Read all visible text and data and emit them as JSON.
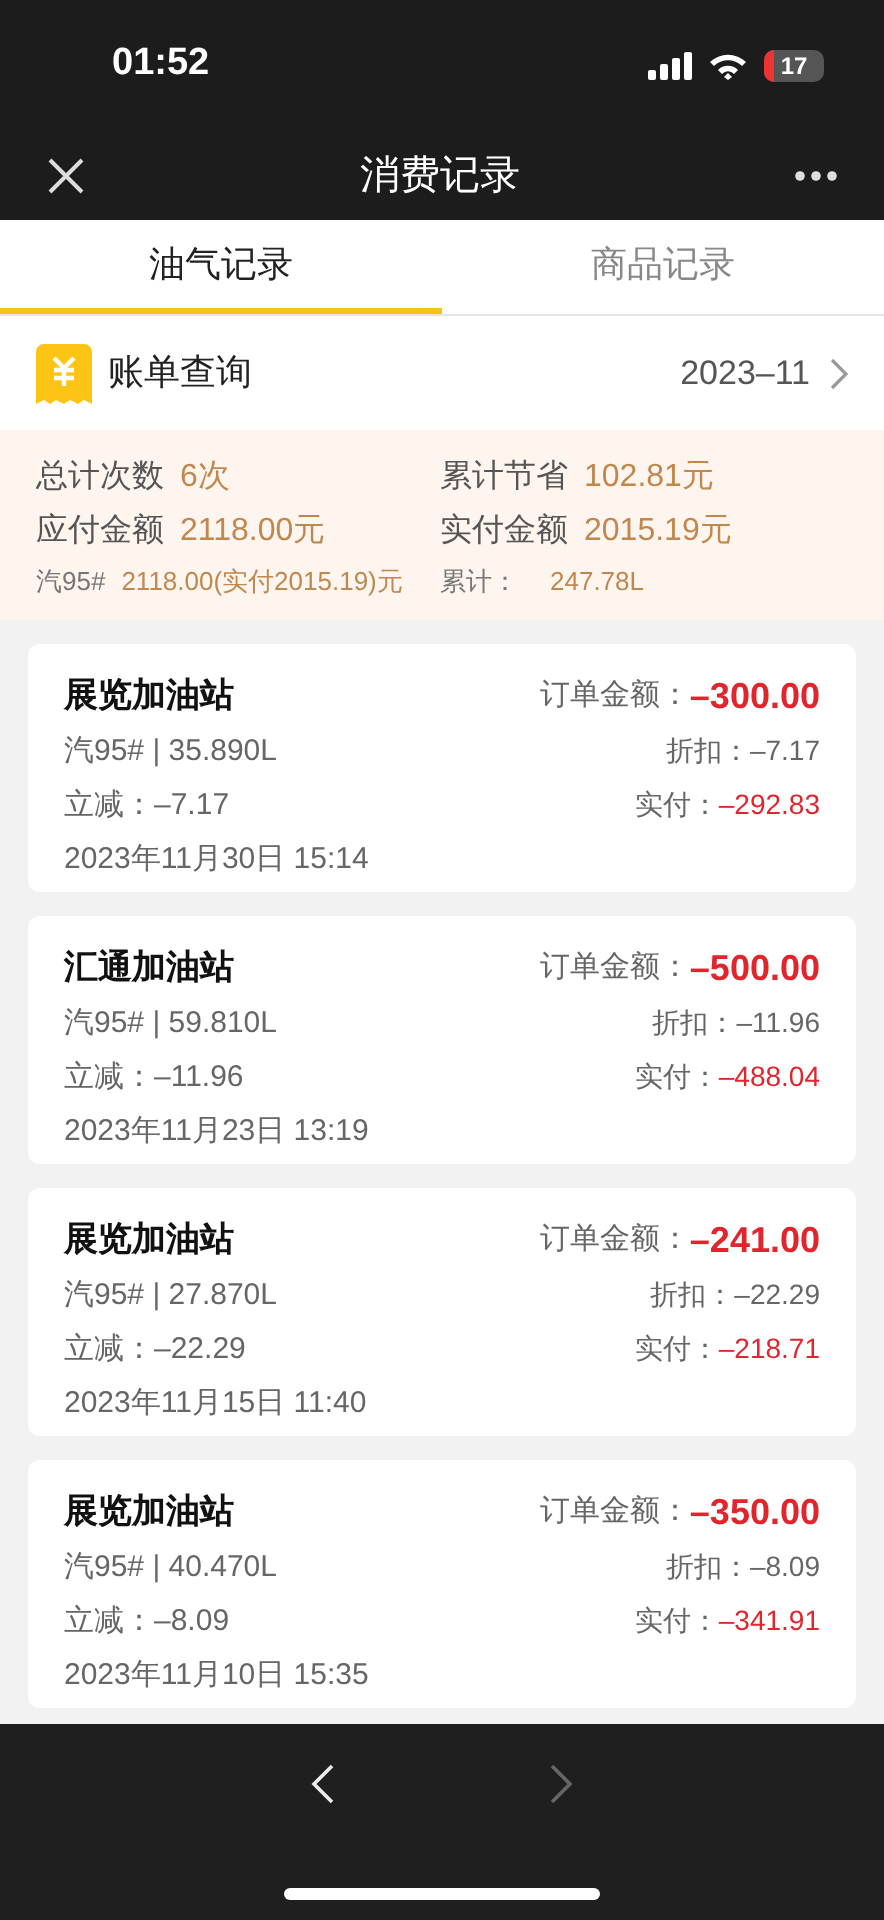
{
  "status_bar": {
    "time": "01:52",
    "battery": "17"
  },
  "nav": {
    "title": "消费记录"
  },
  "tabs": [
    {
      "label": "油气记录",
      "selected": true
    },
    {
      "label": "商品记录",
      "selected": false
    }
  ],
  "bill": {
    "label": "账单查询",
    "month": "2023–11"
  },
  "summary": {
    "rows": [
      {
        "label": "总计次数",
        "value": "6次",
        "label_2": "累计节省",
        "value_2": "102.81元"
      },
      {
        "label": "应付金额",
        "value": "2118.00元",
        "label_2": "实付金额",
        "value_2": "2015.19元"
      }
    ],
    "fuel": {
      "label": "汽95#",
      "value": "2118.00(实付2015.19)元",
      "label_2": "累计：",
      "value_2": "247.78L"
    }
  },
  "records": [
    {
      "station": "展览加油站",
      "fuel": "汽95# | 35.890L",
      "reduction": "立减：–7.17",
      "date": "2023年11月30日 15:14",
      "order_label": "订单金额：",
      "order": "–300.00",
      "discount": "折扣：–7.17",
      "paid_label": "实付：",
      "paid": "–292.83"
    },
    {
      "station": "汇通加油站",
      "fuel": "汽95# | 59.810L",
      "reduction": "立减：–11.96",
      "date": "2023年11月23日 13:19",
      "order_label": "订单金额：",
      "order": "–500.00",
      "discount": "折扣：–11.96",
      "paid_label": "实付：",
      "paid": "–488.04"
    },
    {
      "station": "展览加油站",
      "fuel": "汽95# | 27.870L",
      "reduction": "立减：–22.29",
      "date": "2023年11月15日 11:40",
      "order_label": "订单金额：",
      "order": "–241.00",
      "discount": "折扣：–22.29",
      "paid_label": "实付：",
      "paid": "–218.71"
    },
    {
      "station": "展览加油站",
      "fuel": "汽95# | 40.470L",
      "reduction": "立减：–8.09",
      "date": "2023年11月10日 15:35",
      "order_label": "订单金额：",
      "order": "–350.00",
      "discount": "折扣：–8.09",
      "paid_label": "实付：",
      "paid": "–341.91"
    }
  ],
  "toolbar": {
    "back": {
      "disabled": false
    },
    "forward": {
      "disabled": true
    }
  }
}
